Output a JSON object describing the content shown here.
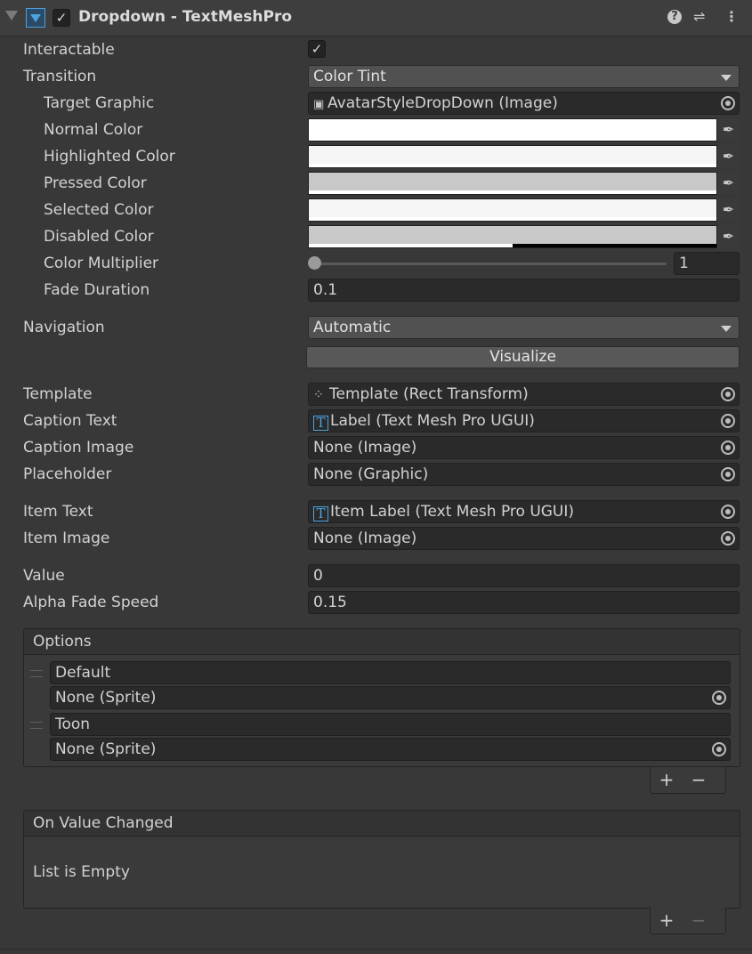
{
  "header": {
    "title": "Dropdown - TextMeshPro",
    "help_icon": "help-icon",
    "presets_icon": "presets-icon",
    "menu_icon": "kebab-menu-icon"
  },
  "props": {
    "interactable": "Interactable",
    "transition": "Transition",
    "transition_value": "Color Tint",
    "target_graphic": "Target Graphic",
    "target_graphic_value": "AvatarStyleDropDown (Image)",
    "normal_color": "Normal Color",
    "highlighted_color": "Highlighted Color",
    "pressed_color": "Pressed Color",
    "selected_color": "Selected Color",
    "disabled_color": "Disabled Color",
    "color_multiplier": "Color Multiplier",
    "color_multiplier_value": "1",
    "fade_duration": "Fade Duration",
    "fade_duration_value": "0.1",
    "navigation": "Navigation",
    "navigation_value": "Automatic",
    "visualize": "Visualize",
    "template": "Template",
    "template_value": "Template (Rect Transform)",
    "caption_text": "Caption Text",
    "caption_text_value": "Label (Text Mesh Pro UGUI)",
    "caption_image": "Caption Image",
    "caption_image_value": "None (Image)",
    "placeholder": "Placeholder",
    "placeholder_value": "None (Graphic)",
    "item_text": "Item Text",
    "item_text_value": "Item Label (Text Mesh Pro UGUI)",
    "item_image": "Item Image",
    "item_image_value": "None (Image)",
    "value": "Value",
    "value_value": "0",
    "alpha_fade_speed": "Alpha Fade Speed",
    "alpha_fade_speed_value": "0.15"
  },
  "colors": {
    "normal": "#ffffff",
    "highlighted": "#f5f5f5",
    "pressed": "#c8c8c8",
    "selected": "#f5f5f5",
    "disabled": "#c8c8c8"
  },
  "options": {
    "title": "Options",
    "items": [
      {
        "text": "Default",
        "sprite": "None (Sprite)"
      },
      {
        "text": "Toon",
        "sprite": "None (Sprite)"
      }
    ],
    "add": "+",
    "remove": "−"
  },
  "on_value_changed": {
    "title": "On Value Changed",
    "empty": "List is Empty",
    "add": "+",
    "remove": "−"
  }
}
